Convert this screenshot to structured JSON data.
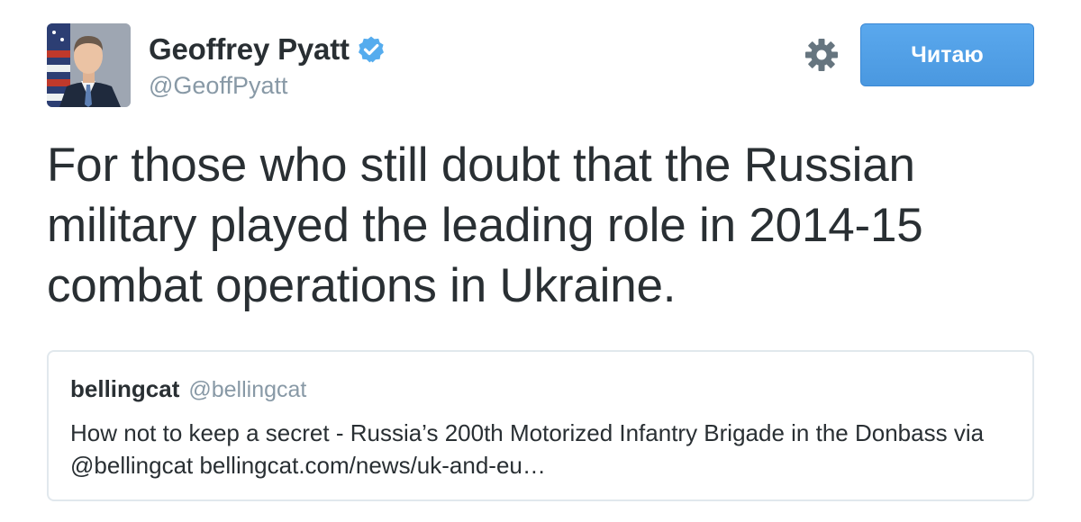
{
  "author": {
    "display_name": "Geoffrey Pyatt",
    "handle": "@GeoffPyatt",
    "verified": true
  },
  "actions": {
    "settings_icon": "gear-icon",
    "follow_label": "Читаю",
    "follow_color": "#55a2ea"
  },
  "tweet": {
    "text": "For those who still doubt that the Russian military played the leading role in 2014-15 combat operations in Ukraine."
  },
  "quoted_tweet": {
    "display_name": "bellingcat",
    "handle": "@bellingcat",
    "text": "How not to keep a secret - Russia’s 200th Motorized Infantry Brigade in the Donbass via @bellingcat bellingcat.com/news/uk-and-eu…"
  },
  "colors": {
    "text": "#292f33",
    "secondary_text": "#8899a6",
    "verified_blue": "#55acee",
    "border": "#e1e8ed"
  }
}
